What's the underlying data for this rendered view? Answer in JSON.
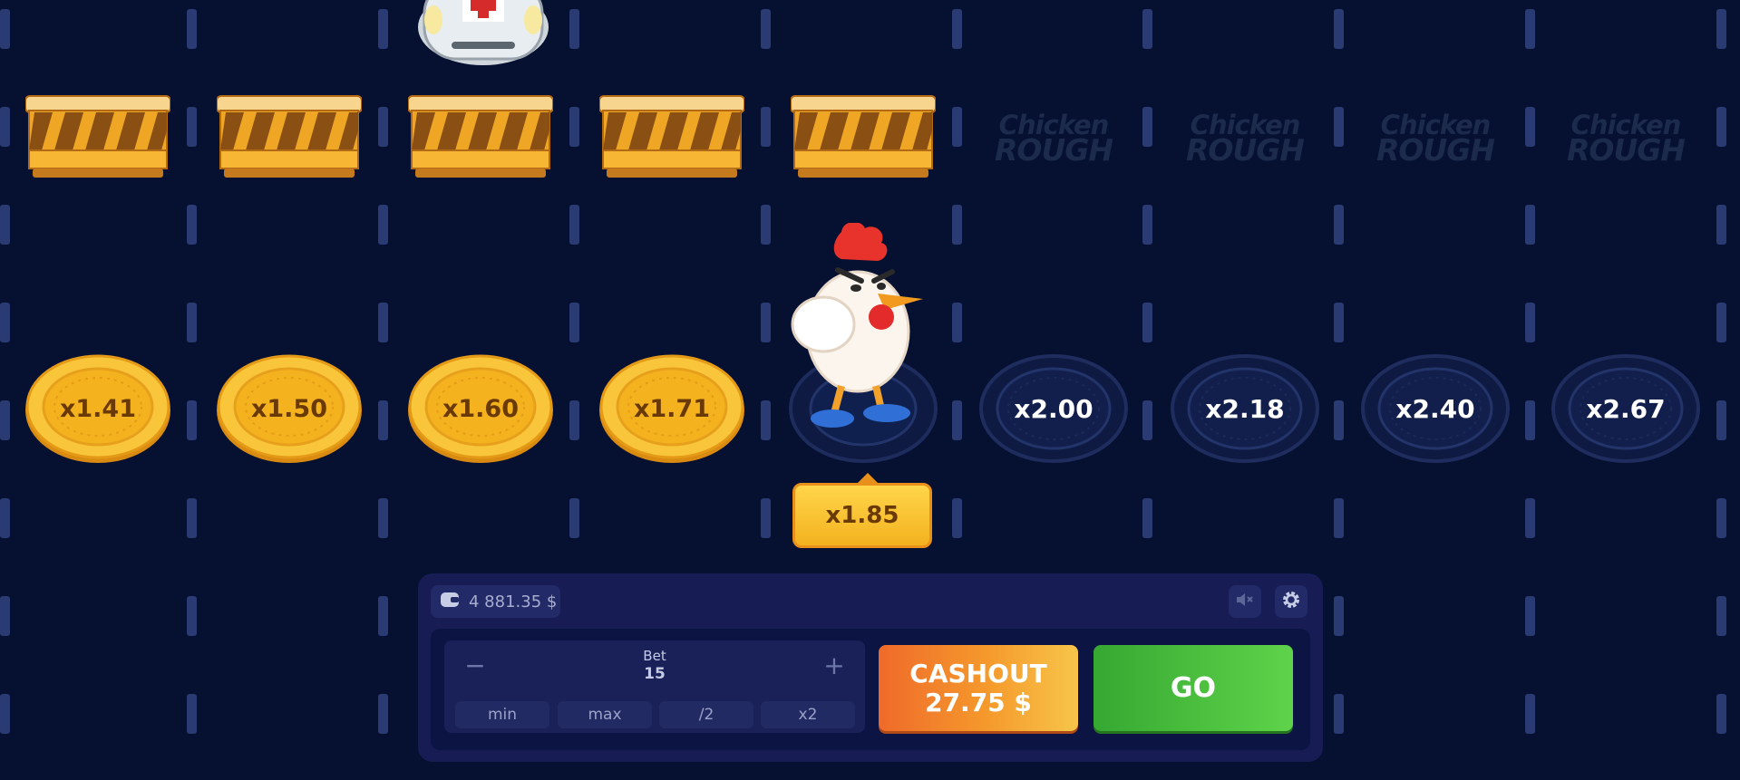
{
  "watermark": {
    "line1": "Chicken",
    "line2": "ROUGH"
  },
  "lanes": [
    {
      "multiplier": "x1.41",
      "state": "passed"
    },
    {
      "multiplier": "x1.50",
      "state": "passed"
    },
    {
      "multiplier": "x1.60",
      "state": "passed"
    },
    {
      "multiplier": "x1.71",
      "state": "passed"
    },
    {
      "multiplier": "x1.85",
      "state": "current"
    },
    {
      "multiplier": "x2.00",
      "state": "upcoming"
    },
    {
      "multiplier": "x2.18",
      "state": "upcoming"
    },
    {
      "multiplier": "x2.40",
      "state": "upcoming"
    },
    {
      "multiplier": "x2.67",
      "state": "upcoming"
    }
  ],
  "current_tag": "x1.85",
  "balance": {
    "amount": "4 881.35 $",
    "icon": "wallet-icon"
  },
  "controls": {
    "mute_icon": "speaker-muted-icon",
    "settings_icon": "gear-icon"
  },
  "bet": {
    "label": "Bet",
    "value": "15",
    "minus": "−",
    "plus": "+",
    "quick": [
      "min",
      "max",
      "/2",
      "x2"
    ]
  },
  "cashout": {
    "label": "CASHOUT",
    "amount": "27.75 $"
  },
  "go": {
    "label": "GO"
  },
  "colors": {
    "background": "#061132",
    "gold": "#f6b51e",
    "cashout": "#f28a2b",
    "go": "#4cc13d"
  }
}
